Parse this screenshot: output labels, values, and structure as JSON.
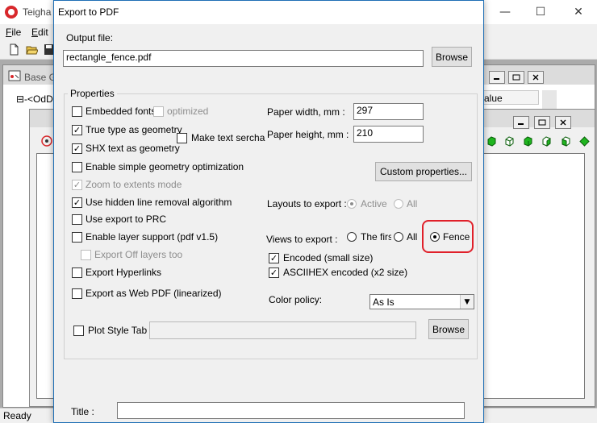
{
  "app": {
    "title": "Teigha",
    "window_controls": {
      "minimize": "—",
      "maximize": "☐",
      "close": "✕"
    },
    "menu": [
      {
        "label_u": "F",
        "label_rest": "ile"
      },
      {
        "label_u": "E",
        "label_rest": "dit"
      }
    ],
    "child_window": {
      "title": "Base G",
      "tree_root": "⊟-<OdDg",
      "value_header": "alue"
    },
    "status": "Ready"
  },
  "dialog": {
    "title": "Export to PDF",
    "output_file": {
      "label": "Output file:",
      "value": "rectangle_fence.pdf",
      "browse": "Browse"
    },
    "properties": {
      "group_label": "Properties",
      "options": {
        "embedded_fonts": {
          "label": "Embedded fonts",
          "checked": false
        },
        "optimized": {
          "label": "optimized",
          "checked": false,
          "disabled": true
        },
        "true_type_geometry": {
          "label": "True type as geometry",
          "checked": true
        },
        "make_text_searchable": {
          "label": "Make text serchable",
          "checked": false
        },
        "shx_text_geometry": {
          "label": "SHX text as geometry",
          "checked": true
        },
        "simple_geometry": {
          "label": "Enable simple geometry optimization",
          "checked": false
        },
        "zoom_extents": {
          "label": "Zoom to extents mode",
          "checked": true,
          "disabled": true
        },
        "hidden_line_removal": {
          "label": "Use hidden line removal algorithm",
          "checked": true
        },
        "export_prc": {
          "label": "Use export to PRC",
          "checked": false
        },
        "layer_support": {
          "label": "Enable layer support (pdf v1.5)",
          "checked": false
        },
        "export_off_layers": {
          "label": "Export Off layers too",
          "checked": false,
          "disabled": true
        },
        "export_hyperlinks": {
          "label": "Export Hyperlinks",
          "checked": false
        },
        "web_pdf": {
          "label": "Export as Web PDF (linearized)",
          "checked": false
        }
      },
      "paper_width": {
        "label": "Paper width, mm :",
        "value": "297"
      },
      "paper_height": {
        "label": "Paper height, mm :",
        "value": "210"
      },
      "custom_properties": "Custom properties...",
      "layouts": {
        "label": "Layouts to export :",
        "active": "Active",
        "all": "All"
      },
      "views": {
        "label": "Views to export :",
        "first": "The firs",
        "all": "All",
        "fence": "Fence"
      },
      "encoded": {
        "label": "Encoded (small size)",
        "checked": true
      },
      "asciihex": {
        "label": "ASCIIHEX encoded (x2 size)",
        "checked": true
      },
      "color_policy": {
        "label": "Color policy:",
        "value": "As Is"
      },
      "plot_style": {
        "label": "Plot Style Table",
        "value": "",
        "browse": "Browse"
      }
    },
    "title_field": {
      "label": "Title :",
      "value": ""
    }
  },
  "colors": {
    "highlight": "#e0202a",
    "dialog_border": "#1f6fb5",
    "cube_green": "#1fb51f"
  }
}
